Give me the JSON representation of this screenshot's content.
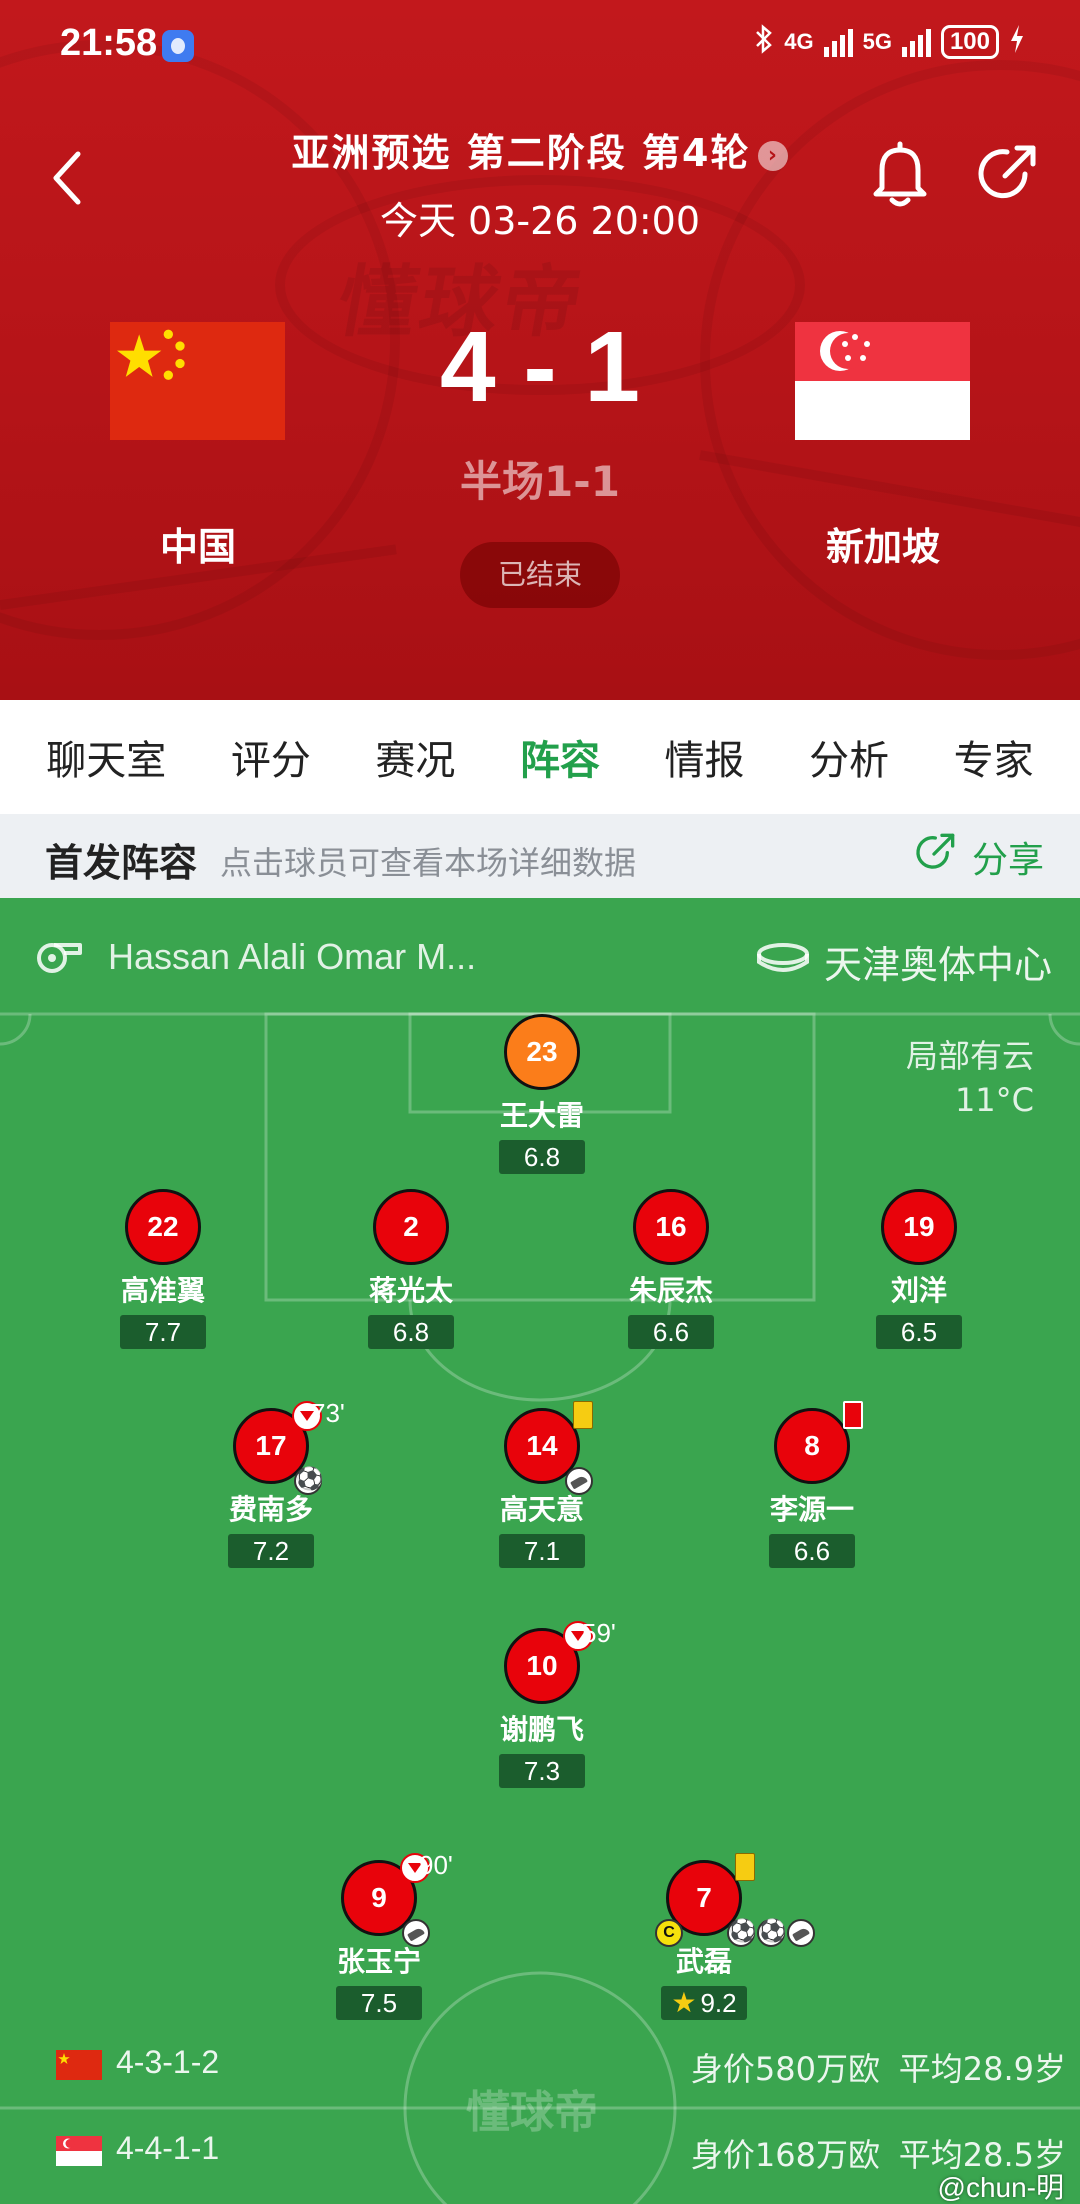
{
  "status_bar": {
    "time": "21:58",
    "network1": "4G",
    "network2": "5G",
    "battery": "100"
  },
  "match": {
    "title": "亚洲预选 第二阶段 第4轮",
    "date": "今天 03-26 20:00",
    "score": "4 - 1",
    "halftime": "半场1-1",
    "home_team": "中国",
    "away_team": "新加坡",
    "status": "已结束",
    "watermark": "懂球帝"
  },
  "tabs": [
    {
      "label": "聊天室"
    },
    {
      "label": "评分"
    },
    {
      "label": "赛况"
    },
    {
      "label": "阵容",
      "active": true
    },
    {
      "label": "情报"
    },
    {
      "label": "分析"
    },
    {
      "label": "专家"
    }
  ],
  "lineup_bar": {
    "title": "首发阵容",
    "hint": "点击球员可查看本场详细数据",
    "share": "分享"
  },
  "pitch_info": {
    "referee": "Hassan Alali Omar M...",
    "venue": "天津奥体中心",
    "weather": "局部有云",
    "temperature": "11°C",
    "watermark": "懂球帝"
  },
  "players": [
    {
      "number": "23",
      "name": "王大雷",
      "rating": "6.8",
      "position": "GK"
    },
    {
      "number": "22",
      "name": "高准翼",
      "rating": "7.7"
    },
    {
      "number": "2",
      "name": "蒋光太",
      "rating": "6.8"
    },
    {
      "number": "16",
      "name": "朱辰杰",
      "rating": "6.6"
    },
    {
      "number": "19",
      "name": "刘洋",
      "rating": "6.5"
    },
    {
      "number": "17",
      "name": "费南多",
      "rating": "7.2",
      "sub_minute": "73'",
      "events": [
        "sub-off",
        "goal"
      ]
    },
    {
      "number": "14",
      "name": "高天意",
      "rating": "7.1",
      "events": [
        "yellow-card",
        "assist"
      ]
    },
    {
      "number": "8",
      "name": "李源一",
      "rating": "6.6",
      "events": [
        "red-card"
      ]
    },
    {
      "number": "10",
      "name": "谢鹏飞",
      "rating": "7.3",
      "sub_minute": "59'",
      "events": [
        "sub-off"
      ]
    },
    {
      "number": "9",
      "name": "张玉宁",
      "rating": "7.5",
      "sub_minute": "90'",
      "events": [
        "sub-off",
        "assist"
      ]
    },
    {
      "number": "7",
      "name": "武磊",
      "rating": "9.2",
      "events": [
        "yellow-card",
        "captain",
        "goal",
        "goal",
        "assist"
      ],
      "man_of_match": true
    }
  ],
  "formations": {
    "home": {
      "formation": "4-3-1-2",
      "value": "身价580万欧",
      "avg_age": "平均28.9岁"
    },
    "away": {
      "formation": "4-4-1-1",
      "value": "身价168万欧",
      "avg_age": "平均28.5岁"
    }
  },
  "credit": "@chun-明",
  "colors": {
    "header_red": "#b51418",
    "accent_green": "#22a04b",
    "pitch_green": "#3aa54f",
    "player_red": "#e8030b",
    "keeper_orange": "#fb7d1a",
    "rating_bg": "#1b5d2d"
  }
}
